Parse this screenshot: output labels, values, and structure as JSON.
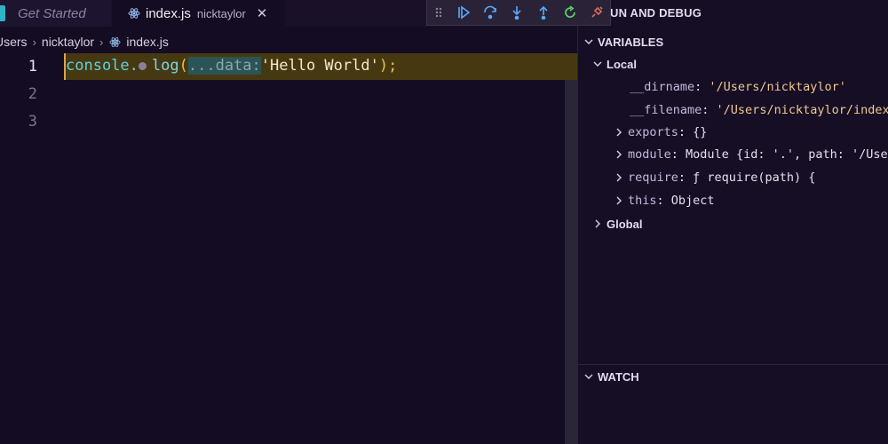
{
  "tabs": [
    {
      "label": "Get Started",
      "active": false
    },
    {
      "label": "index.js",
      "description": "nicktaylor",
      "active": true
    }
  ],
  "breadcrumb": [
    "Users",
    "nicktaylor",
    "index.js"
  ],
  "editor": {
    "line_numbers": [
      "1",
      "2",
      "3"
    ],
    "code": {
      "ident": "console",
      "dot": ".",
      "fn": "log",
      "paren_open": "(",
      "hint": "...data:",
      "string": "'Hello World'",
      "paren_close": ")",
      "semi": ";"
    }
  },
  "debug_toolbar": [
    "drag-handle-icon",
    "continue-icon",
    "step-over-icon",
    "step-into-icon",
    "step-out-icon",
    "restart-icon",
    "disconnect-icon"
  ],
  "panel": {
    "title": "UN AND DEBUG",
    "variables_header": "VARIABLES",
    "watch_header": "WATCH",
    "local_label": "Local",
    "global_label": "Global",
    "variables": [
      {
        "name": "__dirname",
        "value": "'/Users/nicktaylor'",
        "expandable": false
      },
      {
        "name": "__filename",
        "value": "'/Users/nicktaylor/index.j",
        "expandable": false
      },
      {
        "name": "exports",
        "value": "{}",
        "expandable": true
      },
      {
        "name": "module",
        "value": "Module {id: '.', path: '/Users",
        "expandable": true
      },
      {
        "name": "require",
        "value": "ƒ require(path) {",
        "expandable": true
      },
      {
        "name": "this",
        "value": "Object",
        "expandable": true
      }
    ]
  },
  "colors": {
    "accent": "#5fd1e0",
    "highlight": "#463912",
    "string": "#f2e7c9"
  }
}
